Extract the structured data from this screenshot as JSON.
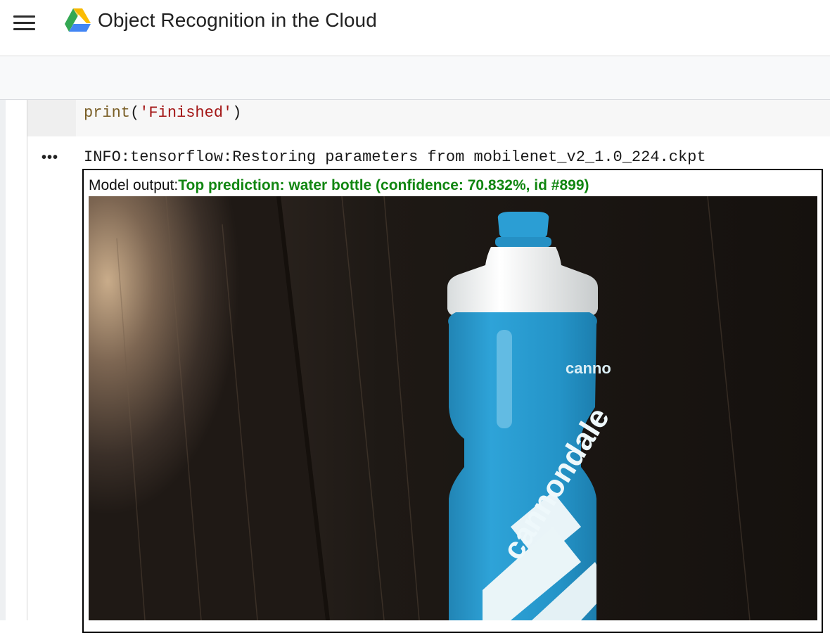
{
  "header": {
    "title": "Object Recognition in the Cloud",
    "menu_icon": "hamburger-menu-icon",
    "logo_icon": "google-drive-logo"
  },
  "cell": {
    "code": {
      "fn": "print",
      "open": "(",
      "string": "'Finished'",
      "close": ")"
    },
    "output_menu_icon": "more-horiz-icon",
    "stream_text": "INFO:tensorflow:Restoring parameters from mobilenet_v2_1.0_224.ckpt",
    "model_output_label": "Model output:",
    "prediction_text": "Top prediction: water bottle (confidence: 70.832%, id #899)",
    "image": {
      "bottle_brand_top": "canno",
      "bottle_brand_side": "cannondale"
    }
  },
  "colors": {
    "prediction": "#118611",
    "bottle_blue": "#2596c9",
    "string_literal": "#a31515",
    "builtin_fn": "#795e26"
  }
}
